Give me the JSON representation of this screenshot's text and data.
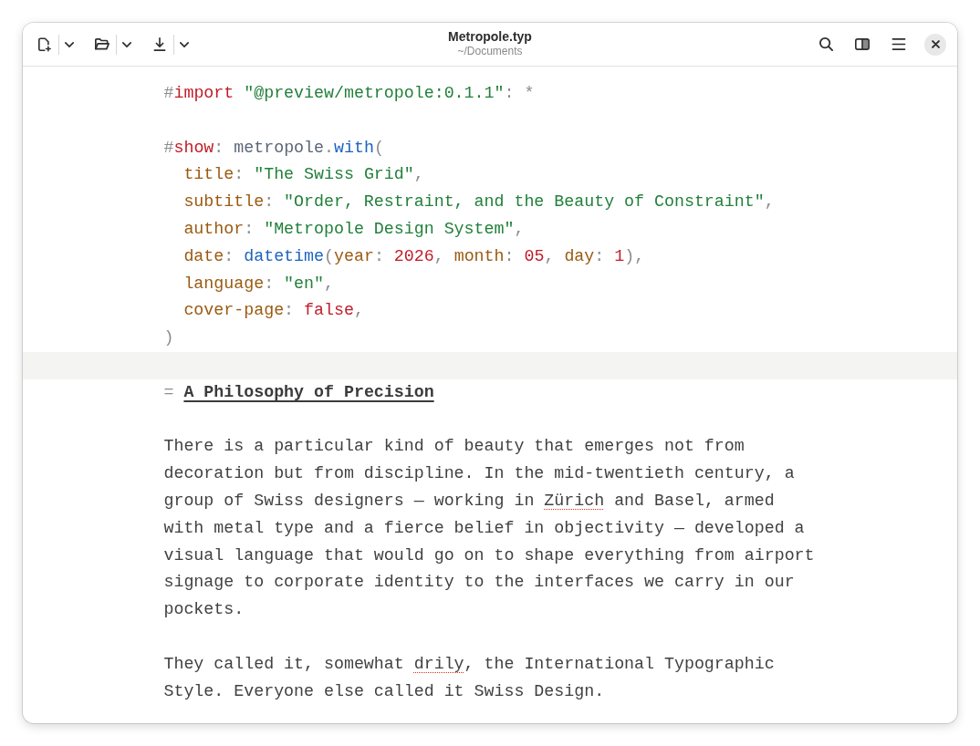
{
  "header": {
    "left_buttons": [
      {
        "kind": "new",
        "dropdown": true
      },
      {
        "kind": "open",
        "dropdown": true
      },
      {
        "kind": "save",
        "dropdown": true
      }
    ],
    "title": "Metropole.typ",
    "subtitle": "~/Documents",
    "right_buttons": [
      {
        "kind": "search"
      },
      {
        "kind": "sidebar"
      },
      {
        "kind": "menu"
      },
      {
        "kind": "close"
      }
    ]
  },
  "editor": {
    "lines": [
      {
        "kind": "code",
        "indent": false,
        "tokens": [
          {
            "kind": "hash",
            "text": "#"
          },
          {
            "kind": "keyword",
            "text": "import "
          },
          {
            "kind": "string",
            "text": "\"@preview/metropole:0.1.1\""
          },
          {
            "kind": "punct",
            "text": ": *"
          }
        ]
      },
      {
        "kind": "blank"
      },
      {
        "kind": "code",
        "indent": false,
        "tokens": [
          {
            "kind": "hash",
            "text": "#"
          },
          {
            "kind": "keyword",
            "text": "show"
          },
          {
            "kind": "punct",
            "text": ": "
          },
          {
            "kind": "ident",
            "text": "metropole"
          },
          {
            "kind": "punct",
            "text": "."
          },
          {
            "kind": "func",
            "text": "with"
          },
          {
            "kind": "punct",
            "text": "("
          }
        ]
      },
      {
        "kind": "code",
        "indent": true,
        "tokens": [
          {
            "kind": "param",
            "text": "title"
          },
          {
            "kind": "punct",
            "text": ": "
          },
          {
            "kind": "string",
            "text": "\"The Swiss Grid\""
          },
          {
            "kind": "punct",
            "text": ","
          }
        ]
      },
      {
        "kind": "code",
        "indent": true,
        "tokens": [
          {
            "kind": "param",
            "text": "subtitle"
          },
          {
            "kind": "punct",
            "text": ": "
          },
          {
            "kind": "string",
            "text": "\"Order, Restraint, and the Beauty of Constraint\""
          },
          {
            "kind": "punct",
            "text": ","
          }
        ]
      },
      {
        "kind": "code",
        "indent": true,
        "tokens": [
          {
            "kind": "param",
            "text": "author"
          },
          {
            "kind": "punct",
            "text": ": "
          },
          {
            "kind": "string",
            "text": "\"Metropole Design System\""
          },
          {
            "kind": "punct",
            "text": ","
          }
        ]
      },
      {
        "kind": "code",
        "indent": true,
        "tokens": [
          {
            "kind": "param",
            "text": "date"
          },
          {
            "kind": "punct",
            "text": ": "
          },
          {
            "kind": "func",
            "text": "datetime"
          },
          {
            "kind": "punct",
            "text": "("
          },
          {
            "kind": "param",
            "text": "year"
          },
          {
            "kind": "punct",
            "text": ": "
          },
          {
            "kind": "number",
            "text": "2026"
          },
          {
            "kind": "punct",
            "text": ", "
          },
          {
            "kind": "param",
            "text": "month"
          },
          {
            "kind": "punct",
            "text": ": "
          },
          {
            "kind": "number",
            "text": "05"
          },
          {
            "kind": "punct",
            "text": ", "
          },
          {
            "kind": "param",
            "text": "day"
          },
          {
            "kind": "punct",
            "text": ": "
          },
          {
            "kind": "number",
            "text": "1"
          },
          {
            "kind": "punct",
            "text": "),"
          }
        ]
      },
      {
        "kind": "code",
        "indent": true,
        "tokens": [
          {
            "kind": "param",
            "text": "language"
          },
          {
            "kind": "punct",
            "text": ": "
          },
          {
            "kind": "string",
            "text": "\"en\""
          },
          {
            "kind": "punct",
            "text": ","
          }
        ]
      },
      {
        "kind": "code",
        "indent": true,
        "tokens": [
          {
            "kind": "param",
            "text": "cover-page"
          },
          {
            "kind": "punct",
            "text": ": "
          },
          {
            "kind": "bool",
            "text": "false"
          },
          {
            "kind": "punct",
            "text": ","
          }
        ]
      },
      {
        "kind": "code",
        "indent": false,
        "tokens": [
          {
            "kind": "punct",
            "text": ")"
          }
        ]
      },
      {
        "kind": "cursor_line"
      },
      {
        "kind": "heading",
        "tokens": [
          {
            "kind": "marker",
            "text": "= "
          },
          {
            "kind": "heading",
            "text": "A Philosophy of Precision"
          }
        ]
      },
      {
        "kind": "blank"
      },
      {
        "kind": "paragraph",
        "segments": [
          {
            "text": "There is a particular kind of beauty that emerges not from decoration but from discipline. In the mid-twentieth century, a group of Swiss designers — working in ",
            "misspelled": false
          },
          {
            "text": "Zürich",
            "misspelled": true
          },
          {
            "text": " and Basel, armed with metal type and a fierce belief in objectivity — developed a visual language that would go on to shape everything from airport signage to corporate identity to the interfaces we carry in our pockets.",
            "misspelled": false
          }
        ]
      },
      {
        "kind": "blank"
      },
      {
        "kind": "paragraph",
        "segments": [
          {
            "text": "They called it, somewhat ",
            "misspelled": false
          },
          {
            "text": "drily",
            "misspelled": true
          },
          {
            "text": ", the International Typographic Style. Everyone else called it Swiss Design.",
            "misspelled": false
          }
        ]
      }
    ]
  }
}
